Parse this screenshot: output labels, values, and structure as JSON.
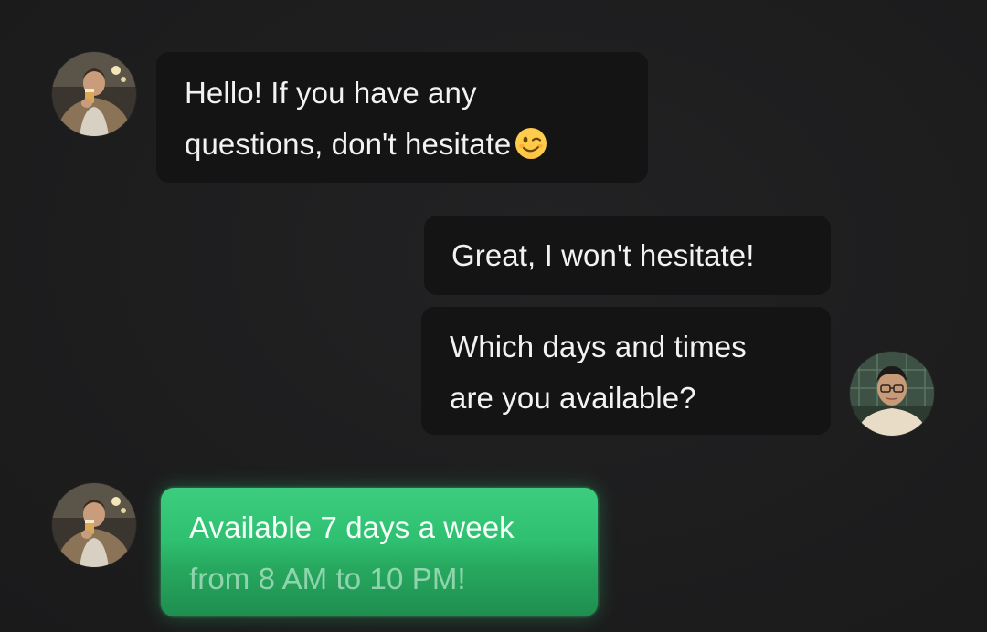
{
  "messages": [
    {
      "sender": "agent",
      "lines": [
        "Hello! If you have any",
        "questions, don't hesitate"
      ],
      "emoji": "winking-face-emoji"
    },
    {
      "sender": "user",
      "lines": [
        "Great, I won't hesitate!"
      ]
    },
    {
      "sender": "user",
      "lines": [
        "Which days and times",
        "are you available?"
      ]
    },
    {
      "sender": "agent",
      "lines": [
        "Available 7 days a week",
        "from 8 AM to 10 PM!"
      ],
      "style": "highlight"
    }
  ],
  "colors": {
    "background": "#1f1f20",
    "bubble": "#141414",
    "text": "#f2f2f2",
    "highlight_bubble": "#2fbf71"
  },
  "icons": {
    "agent_avatar": "agent-avatar-photo",
    "user_avatar": "user-avatar-photo"
  }
}
